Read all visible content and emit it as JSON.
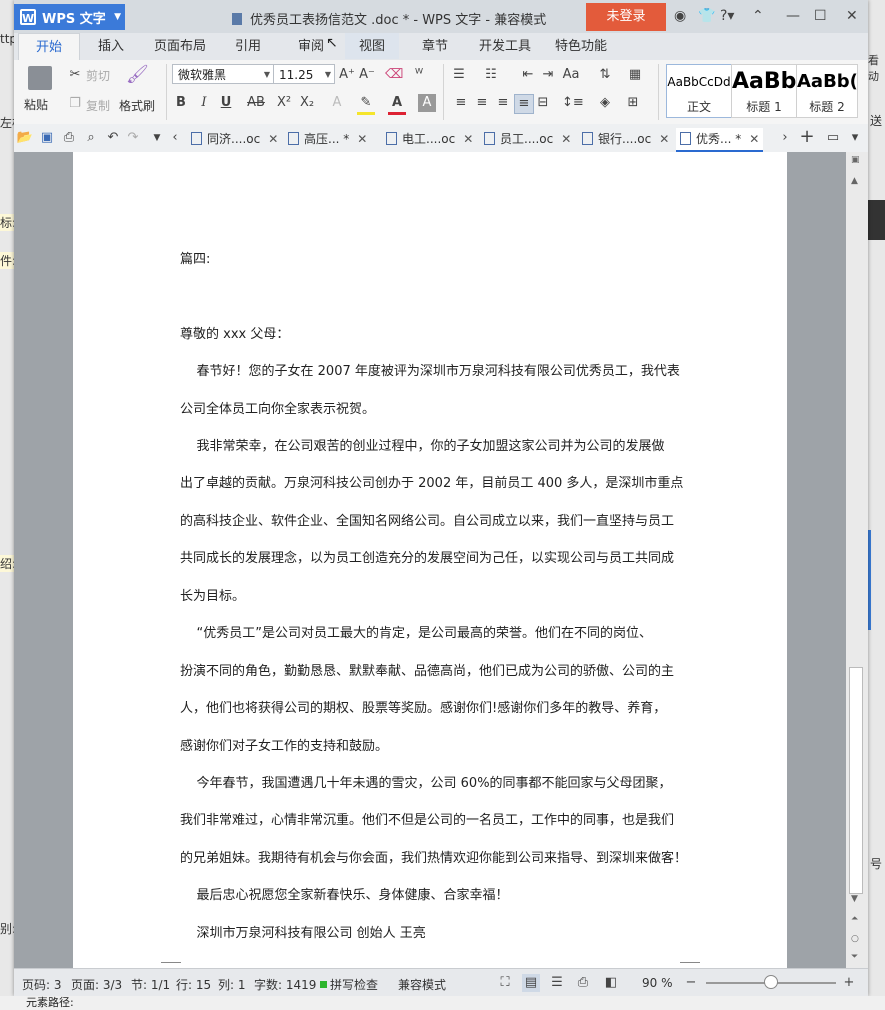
{
  "background": {
    "left_fragments": [
      "ttp",
      "左栏",
      "标:",
      "件:",
      "绍:",
      "别:"
    ],
    "right_fragments": [
      "看动",
      "送",
      "号"
    ],
    "bottom_text": "元素路径:"
  },
  "titlebar": {
    "app_name": "WPS 文字",
    "document_title": "优秀员工表扬信范文 .doc * - WPS 文字 - 兼容模式",
    "login_label": "未登录"
  },
  "tabs": [
    "开始",
    "插入",
    "页面布局",
    "引用",
    "审阅",
    "视图",
    "章节",
    "开发工具",
    "特色功能"
  ],
  "active_tab": "开始",
  "ribbon": {
    "paste": "粘贴",
    "cut": "剪切",
    "copy": "复制",
    "format_painter": "格式刷",
    "font_name": "微软雅黑",
    "font_size": "11.25",
    "bold": "B",
    "italic": "I",
    "underline": "U",
    "strike": "AB",
    "superscript": "X²",
    "subscript": "X₂",
    "styles": [
      {
        "sample": "AaBbCcDd",
        "name": "正文"
      },
      {
        "sample": "AaBb",
        "name": "标题 1"
      },
      {
        "sample": "AaBb(",
        "name": "标题 2"
      }
    ]
  },
  "document_tabs": [
    {
      "label": "同济....oc",
      "active": false
    },
    {
      "label": "高压... *",
      "active": false
    },
    {
      "label": "电工....oc",
      "active": false
    },
    {
      "label": "员工....oc",
      "active": false
    },
    {
      "label": "银行....oc",
      "active": false
    },
    {
      "label": "优秀... *",
      "active": true
    }
  ],
  "document": {
    "paragraphs": [
      "篇四:",
      "尊敬的 xxx 父母：",
      "    春节好！您的子女在 2007 年度被评为深圳市万泉河科技有限公司优秀员工，我代表",
      "公司全体员工向你全家表示祝贺。",
      "    我非常荣幸，在公司艰苦的创业过程中，你的子女加盟这家公司并为公司的发展做",
      "出了卓越的贡献。万泉河科技公司创办于 2002 年，目前员工 400 多人，是深圳市重点",
      "的高科技企业、软件企业、全国知名网络公司。自公司成立以来，我们一直坚持与员工",
      "共同成长的发展理念，以为员工创造充分的发展空间为己任，以实现公司与员工共同成",
      "长为目标。",
      "    “优秀员工”是公司对员工最大的肯定，是公司最高的荣誉。他们在不同的岗位、",
      "扮演不同的角色，勤勤恳恳、默默奉献、品德高尚，他们已成为公司的骄傲、公司的主",
      "人，他们也将获得公司的期权、股票等奖励。感谢你们!感谢你们多年的教导、养育，",
      "感谢你们对子女工作的支持和鼓励。",
      "    今年春节，我国遭遇几十年未遇的雪灾，公司 60%的同事都不能回家与父母团聚，",
      "我们非常难过，心情非常沉重。他们不但是公司的一名员工，工作中的同事，也是我们",
      "的兄弟姐妹。我期待有机会与你会面，我们热情欢迎你能到公司来指导、到深圳来做客！",
      "    最后忠心祝愿您全家新春快乐、身体健康、合家幸福！",
      "    深圳市万泉河科技有限公司 创始人 王亮"
    ]
  },
  "statusbar": {
    "page": "页码: 3",
    "pages": "页面: 3/3",
    "section": "节: 1/1",
    "line": "行: 15",
    "column": "列: 1",
    "word_count": "字数: 1419",
    "spell_check": "拼写检查",
    "compat_mode": "兼容模式",
    "zoom": "90 %",
    "zoom_level": 0.5
  },
  "colors": {
    "accent_blue": "#2a6ad0",
    "login_red": "#e35b3b",
    "logo_blue": "#3b7ad9",
    "status_green": "#2db52d"
  }
}
